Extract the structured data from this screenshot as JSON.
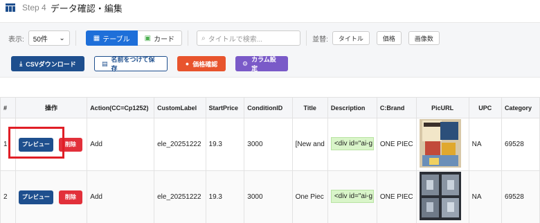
{
  "header": {
    "step": "Step 4",
    "title": "データ確認・編集"
  },
  "toolbar": {
    "display_label": "表示:",
    "page_size": "50件",
    "view_table": "テーブル",
    "view_card": "カード",
    "search_placeholder": "タイトルで検索...",
    "sort_label": "並替:",
    "sort_title": "タイトル",
    "sort_price": "価格",
    "sort_images": "画像数",
    "csv_download": "CSVダウンロード",
    "save_as": "名前をつけて保存",
    "price_check": "価格確認",
    "column_settings": "カラム設定"
  },
  "table": {
    "headers": [
      "#",
      "操作",
      "Action(CC=Cp1252)",
      "CustomLabel",
      "StartPrice",
      "ConditionID",
      "Title",
      "Description",
      "C:Brand",
      "PicURL",
      "UPC",
      "Category"
    ],
    "preview_label": "プレビュー",
    "delete_label": "削除",
    "rows": [
      {
        "num": "1",
        "action": "Add",
        "custom_label": "ele_20251222",
        "start_price": "19.3",
        "condition_id": "3000",
        "title": "[New and",
        "description": "<div id=\"ai-g",
        "brand": "ONE PIEC",
        "upc": "NA",
        "category": "69528"
      },
      {
        "num": "2",
        "action": "Add",
        "custom_label": "ele_20251222",
        "start_price": "19.3",
        "condition_id": "3000",
        "title": "One Piec",
        "description": "<div id=\"ai-g",
        "brand": "ONE PIEC",
        "upc": "NA",
        "category": "69528"
      }
    ]
  },
  "colors": {
    "primary": "#1e4f8e",
    "active": "#1e6fd9",
    "danger": "#e2303a",
    "orange": "#e8542d",
    "purple": "#7a5ac8",
    "highlight": "#e01e26"
  }
}
